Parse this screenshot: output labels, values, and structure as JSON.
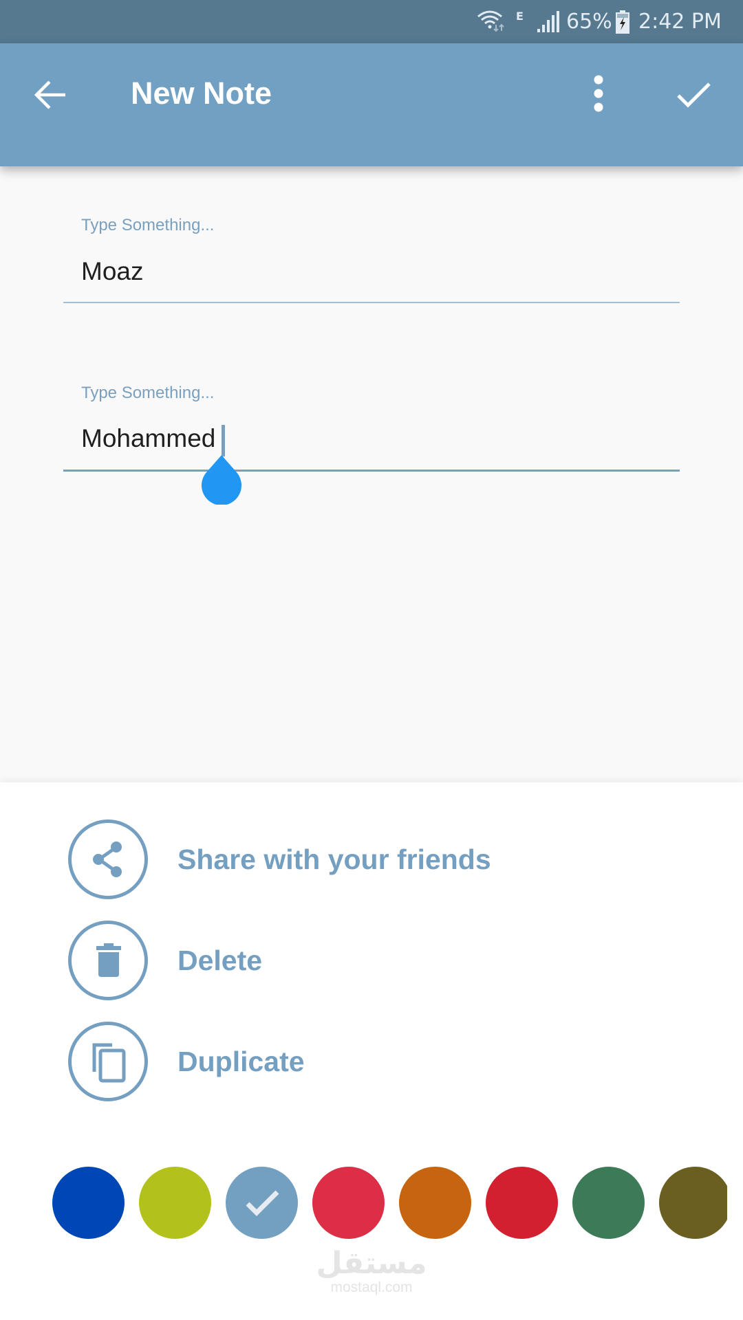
{
  "status_bar": {
    "network_type": "E",
    "battery_percent": "65%",
    "time": "2:42 PM",
    "icons": [
      "wifi-icon",
      "signal-icon",
      "battery-charging-icon"
    ]
  },
  "app_bar": {
    "title": "New Note",
    "back_icon": "arrow-left-icon",
    "menu_icon": "more-vert-icon",
    "save_icon": "check-icon"
  },
  "fields": [
    {
      "label": "Type Something...",
      "value": "Moaz",
      "focused": false
    },
    {
      "label": "Type Something...",
      "value": "Mohammed",
      "focused": true
    }
  ],
  "actions": [
    {
      "label": "Share with your friends",
      "icon": "share-icon"
    },
    {
      "label": "Delete",
      "icon": "trash-icon"
    },
    {
      "label": "Duplicate",
      "icon": "copy-icon"
    }
  ],
  "colors": {
    "accent": "#749fc1",
    "status_bar": "#56798f",
    "app_bar": "#71a0c2",
    "cursor_handle": "#2196f3"
  },
  "swatches": [
    {
      "color": "#0047b5",
      "selected": false
    },
    {
      "color": "#b3c11d",
      "selected": false
    },
    {
      "color": "#739fc1",
      "selected": true
    },
    {
      "color": "#dc2e46",
      "selected": false
    },
    {
      "color": "#c7640f",
      "selected": false
    },
    {
      "color": "#d32030",
      "selected": false
    },
    {
      "color": "#3c7a58",
      "selected": false
    },
    {
      "color": "#6a5e20",
      "selected": false
    }
  ],
  "watermark": {
    "arabic": "مستقل",
    "latin": "mostaql.com"
  }
}
